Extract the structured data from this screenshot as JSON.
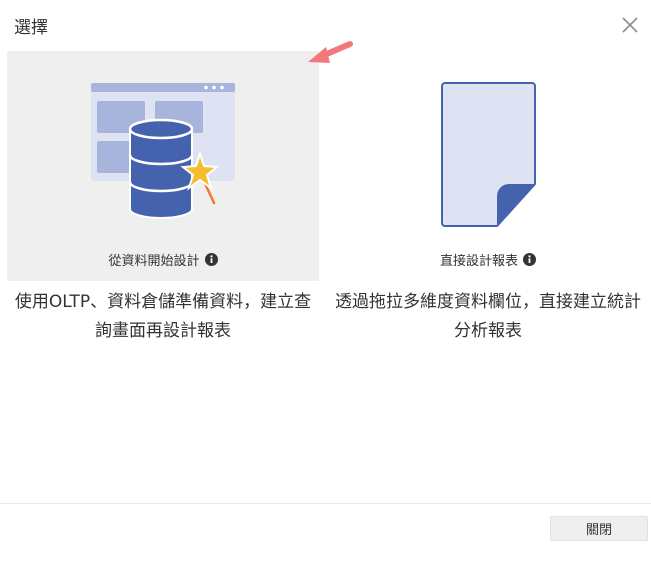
{
  "dialog": {
    "title": "選擇",
    "close_label": "關閉"
  },
  "options": [
    {
      "label": "從資料開始設計",
      "description": "使用OLTP、資料倉儲準備資料，建立查詢畫面再設計報表",
      "icon": "database-design-icon",
      "selected": true
    },
    {
      "label": "直接設計報表",
      "description": "透過拖拉多維度資料欄位，直接建立統計分析報表",
      "icon": "blank-report-icon",
      "selected": false
    }
  ],
  "colors": {
    "accent_blue": "#4462ad",
    "light_blue": "#dde3f2",
    "mid_blue": "#a7b5dc",
    "star_yellow": "#f5be2e",
    "arrow_pink": "#f2787c",
    "selected_bg": "#efefef"
  }
}
